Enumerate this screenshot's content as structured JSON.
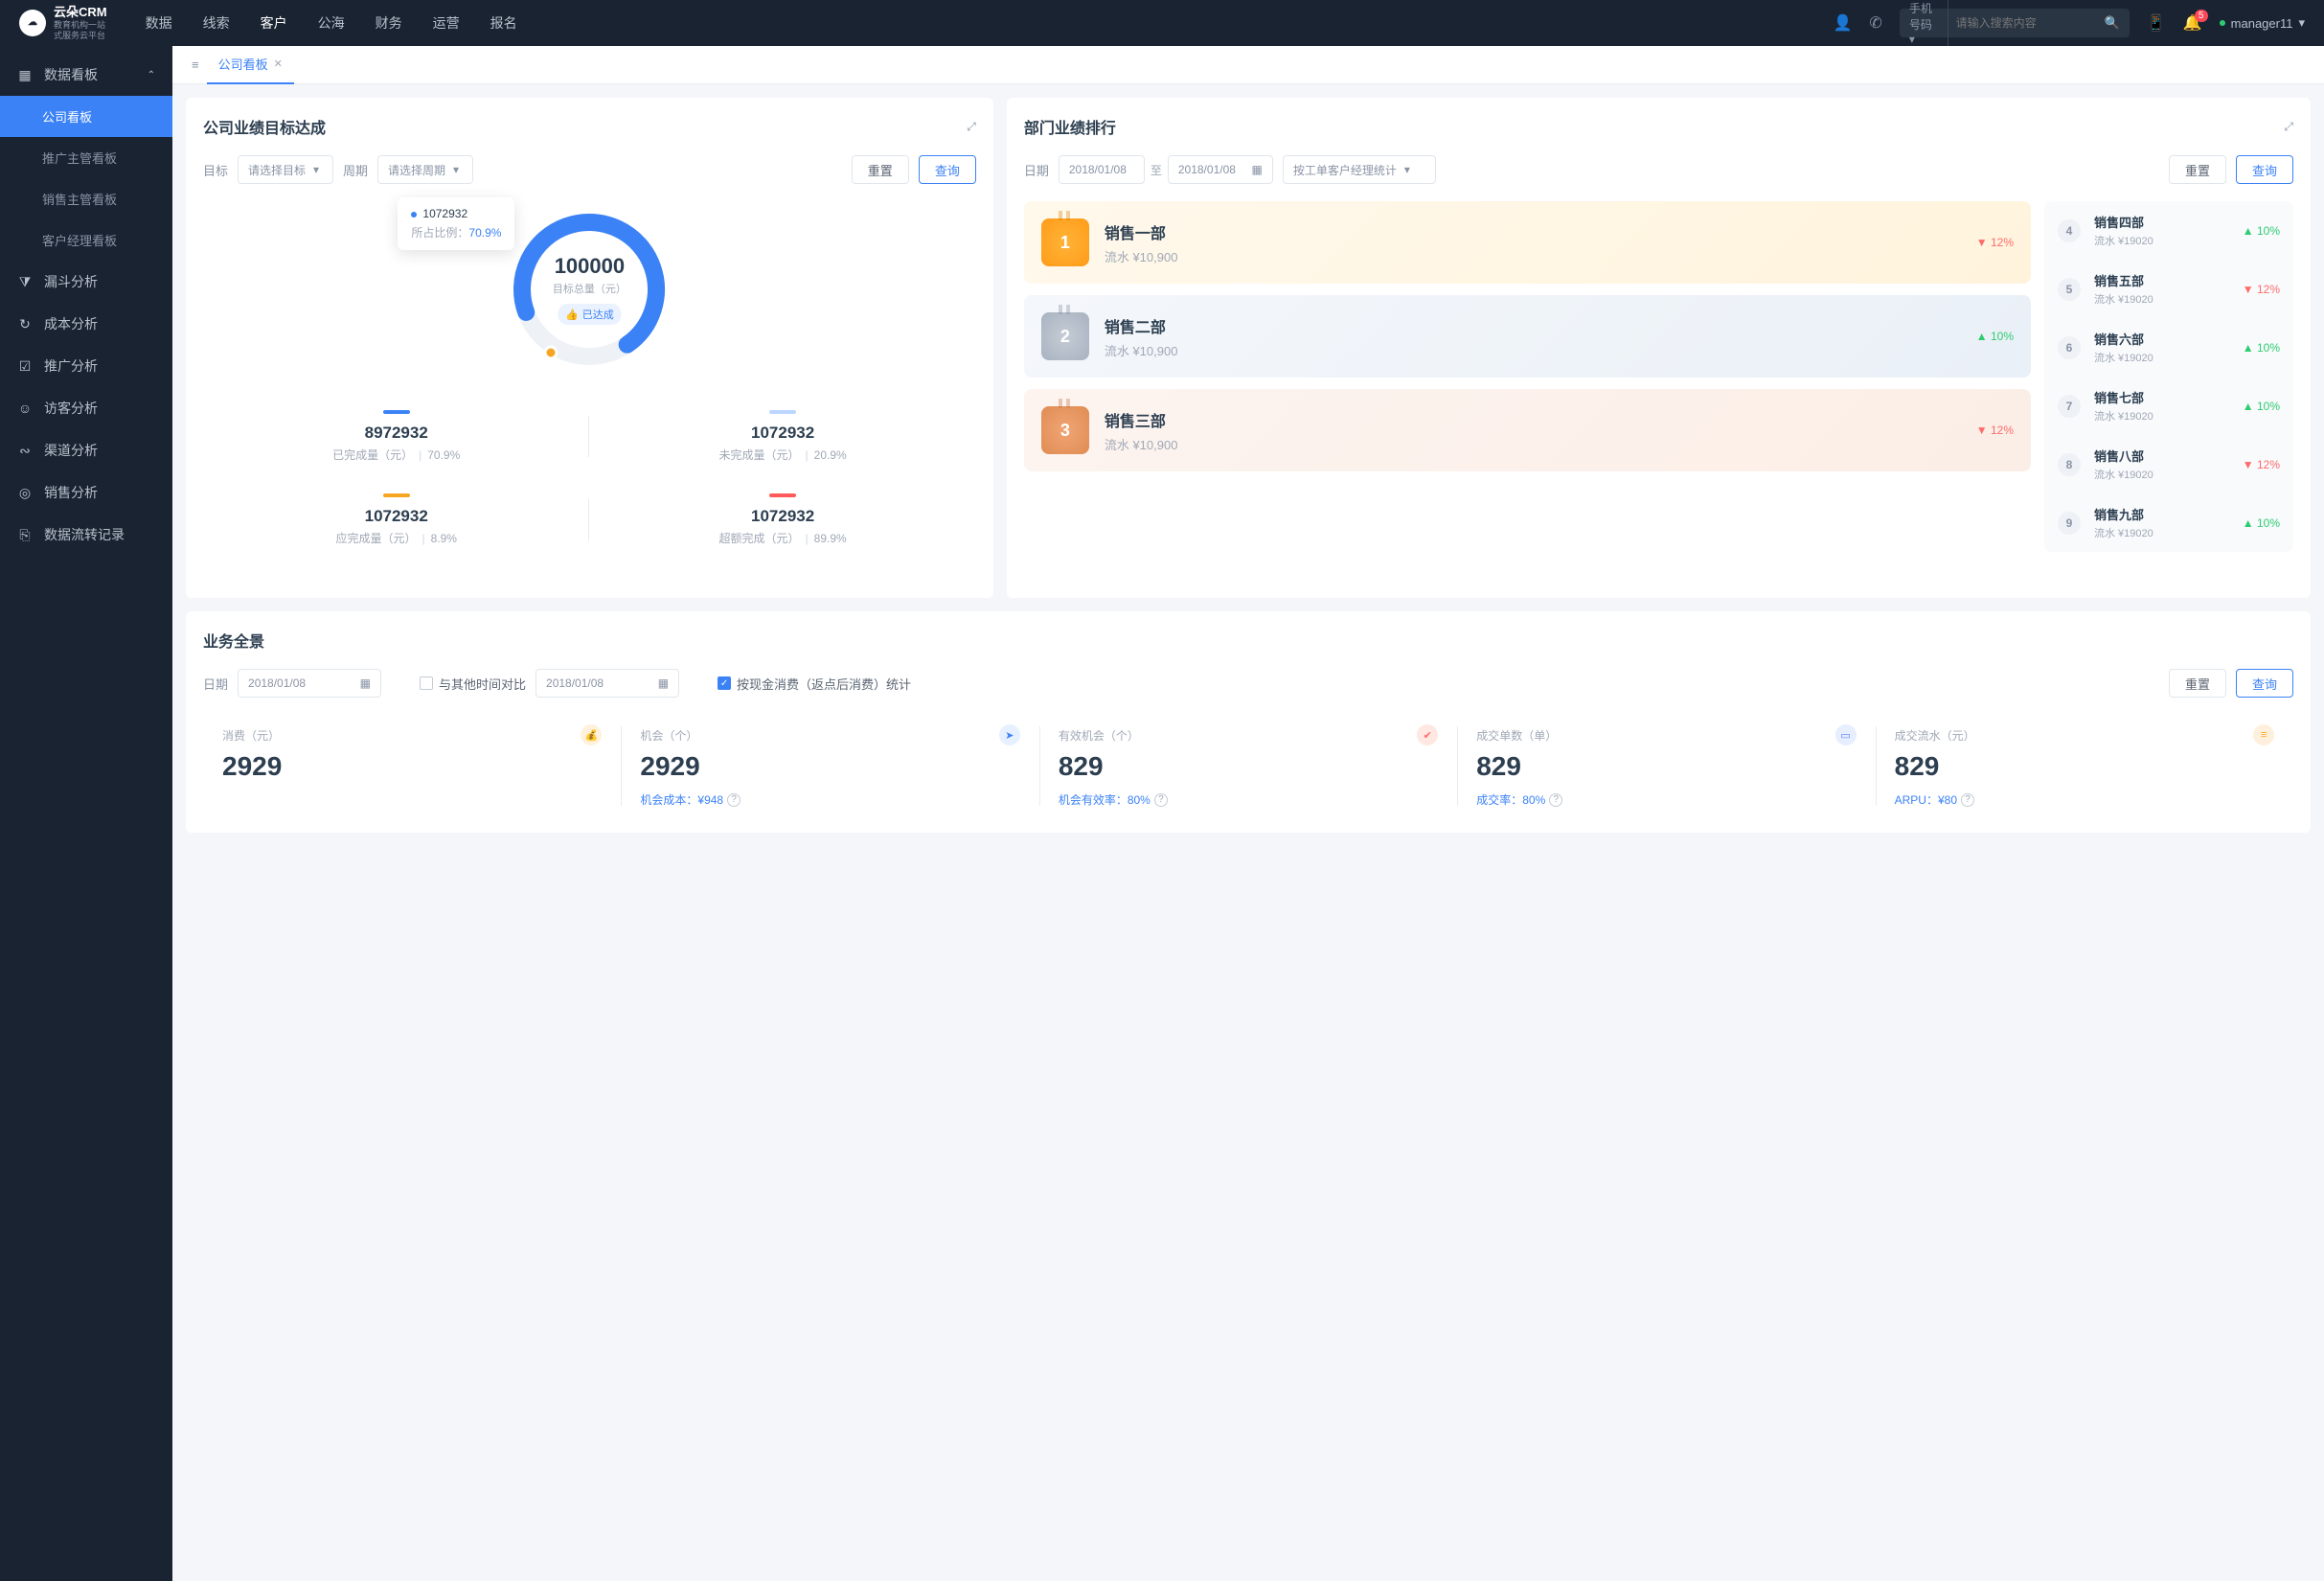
{
  "logo": {
    "brand": "云朵CRM",
    "sub1": "教育机构一站",
    "sub2": "式服务云平台"
  },
  "topnav": [
    "数据",
    "线索",
    "客户",
    "公海",
    "财务",
    "运营",
    "报名"
  ],
  "topnav_active": 2,
  "search": {
    "type": "手机号码",
    "placeholder": "请输入搜索内容"
  },
  "notif_count": "5",
  "username": "manager11",
  "sidebar": {
    "group": "数据看板",
    "subs": [
      "公司看板",
      "推广主管看板",
      "销售主管看板",
      "客户经理看板"
    ],
    "sub_active": 0,
    "items": [
      {
        "icon": "⧩",
        "label": "漏斗分析"
      },
      {
        "icon": "↻",
        "label": "成本分析"
      },
      {
        "icon": "☑",
        "label": "推广分析"
      },
      {
        "icon": "☺",
        "label": "访客分析"
      },
      {
        "icon": "∾",
        "label": "渠道分析"
      },
      {
        "icon": "◎",
        "label": "销售分析"
      },
      {
        "icon": "⎘",
        "label": "数据流转记录"
      }
    ]
  },
  "tab": {
    "label": "公司看板"
  },
  "goal_card": {
    "title": "公司业绩目标达成",
    "target_label": "目标",
    "target_ph": "请选择目标",
    "period_label": "周期",
    "period_ph": "请选择周期",
    "reset": "重置",
    "query": "查询",
    "tooltip_val": "1072932",
    "tooltip_lbl": "所占比例：",
    "tooltip_pct": "70.9%",
    "center_num": "100000",
    "center_sub": "目标总量（元）",
    "center_badge": "已达成",
    "stats": [
      {
        "color": "#3b82f6",
        "num": "8972932",
        "lbl": "已完成量（元）",
        "pct": "70.9%"
      },
      {
        "color": "#bcd6ff",
        "num": "1072932",
        "lbl": "未完成量（元）",
        "pct": "20.9%"
      },
      {
        "color": "#f6a623",
        "num": "1072932",
        "lbl": "应完成量（元）",
        "pct": "8.9%"
      },
      {
        "color": "#ff5a5a",
        "num": "1072932",
        "lbl": "超额完成（元）",
        "pct": "89.9%"
      }
    ]
  },
  "rank_card": {
    "title": "部门业绩排行",
    "date_label": "日期",
    "date_from": "2018/01/08",
    "date_mid": "至",
    "date_to": "2018/01/08",
    "stat_by": "按工单客户经理统计",
    "reset": "重置",
    "query": "查询",
    "top3": [
      {
        "class": "gold",
        "rank": "1",
        "name": "销售一部",
        "amount": "流水 ¥10,900",
        "dir": "down",
        "delta": "12%"
      },
      {
        "class": "silver",
        "rank": "2",
        "name": "销售二部",
        "amount": "流水 ¥10,900",
        "dir": "up",
        "delta": "10%"
      },
      {
        "class": "bronze",
        "rank": "3",
        "name": "销售三部",
        "amount": "流水 ¥10,900",
        "dir": "down",
        "delta": "12%"
      }
    ],
    "rest": [
      {
        "pos": "4",
        "name": "销售四部",
        "amount": "流水 ¥19020",
        "dir": "up",
        "delta": "10%"
      },
      {
        "pos": "5",
        "name": "销售五部",
        "amount": "流水 ¥19020",
        "dir": "down",
        "delta": "12%"
      },
      {
        "pos": "6",
        "name": "销售六部",
        "amount": "流水 ¥19020",
        "dir": "up",
        "delta": "10%"
      },
      {
        "pos": "7",
        "name": "销售七部",
        "amount": "流水 ¥19020",
        "dir": "up",
        "delta": "10%"
      },
      {
        "pos": "8",
        "name": "销售八部",
        "amount": "流水 ¥19020",
        "dir": "down",
        "delta": "12%"
      },
      {
        "pos": "9",
        "name": "销售九部",
        "amount": "流水 ¥19020",
        "dir": "up",
        "delta": "10%"
      }
    ]
  },
  "overview_card": {
    "title": "业务全景",
    "date_label": "日期",
    "date": "2018/01/08",
    "compare_label": "与其他时间对比",
    "compare_date": "2018/01/08",
    "byspend_label": "按现金消费（返点后消费）统计",
    "reset": "重置",
    "query": "查询",
    "metrics": [
      {
        "label": "消费（元）",
        "num": "2929",
        "sub": "",
        "iconBg": "#fff1dc",
        "iconFg": "#f6a623",
        "ic": "💰"
      },
      {
        "label": "机会（个）",
        "num": "2929",
        "sub": "机会成本：¥948",
        "iconBg": "#e6f0ff",
        "iconFg": "#3b82f6",
        "ic": "➤"
      },
      {
        "label": "有效机会（个）",
        "num": "829",
        "sub": "机会有效率：80%",
        "iconBg": "#ffe7e2",
        "iconFg": "#ff6b6b",
        "ic": "✔"
      },
      {
        "label": "成交单数（单）",
        "num": "829",
        "sub": "成交率：80%",
        "iconBg": "#e6eeff",
        "iconFg": "#5a7cff",
        "ic": "▭"
      },
      {
        "label": "成交流水（元）",
        "num": "829",
        "sub": "ARPU：¥80",
        "iconBg": "#fff0dd",
        "iconFg": "#f6a623",
        "ic": "≡"
      }
    ]
  },
  "chart_data": {
    "type": "pie",
    "title": "公司业绩目标达成",
    "total": 100000,
    "series": [
      {
        "name": "已完成量（元）",
        "value": 8972932,
        "pct": 70.9,
        "color": "#3b82f6"
      },
      {
        "name": "未完成量（元）",
        "value": 1072932,
        "pct": 20.9,
        "color": "#bcd6ff"
      },
      {
        "name": "应完成量（元）",
        "value": 1072932,
        "pct": 8.9,
        "color": "#f6a623"
      },
      {
        "name": "超额完成（元）",
        "value": 1072932,
        "pct": 89.9,
        "color": "#ff5a5a"
      }
    ]
  }
}
